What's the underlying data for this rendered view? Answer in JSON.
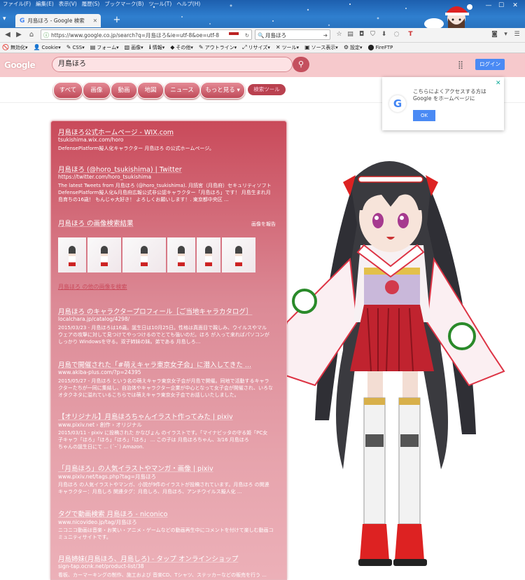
{
  "browser": {
    "menu": [
      "ファイル(F)",
      "編集(E)",
      "表示(V)",
      "履歴(S)",
      "ブックマーク(B)",
      "ツール(T)",
      "ヘルプ(H)"
    ],
    "tab_title": "月島ほろ - Google 検索",
    "url": "https://www.google.co.jp/search?q=月島ほろ&ie=utf-8&oe=utf-8",
    "search_value": "月島ほろ",
    "bookmarks": [
      {
        "icon": "🚫",
        "label": "無効化▾"
      },
      {
        "icon": "👤",
        "label": "Cookie▾"
      },
      {
        "icon": "✎",
        "label": "CSS▾"
      },
      {
        "icon": "▤",
        "label": "フォーム▾"
      },
      {
        "icon": "▧",
        "label": "画像▾"
      },
      {
        "icon": "ℹ",
        "label": "情報▾"
      },
      {
        "icon": "◆",
        "label": "その他▾"
      },
      {
        "icon": "✎",
        "label": "アウトライン▾"
      },
      {
        "icon": "⤢",
        "label": "リサイズ▾"
      },
      {
        "icon": "✕",
        "label": "ツール▾"
      },
      {
        "icon": "▣",
        "label": "ソース表示▾"
      },
      {
        "icon": "⚙",
        "label": "設定▾"
      },
      {
        "icon": "⬤",
        "label": "FireFTP"
      }
    ]
  },
  "google": {
    "logo": "Google",
    "query": "月島ほろ",
    "login": "ログイン",
    "tabs": [
      "すべて",
      "画像",
      "動画",
      "地図",
      "ニュース",
      "もっと見る ▾"
    ],
    "tools": "検索ツール",
    "popup": {
      "text": "こちらによくアクセスする方は Google をホームページに",
      "ok": "OK"
    }
  },
  "results": [
    {
      "title": "月島ほろ公式ホームページ - WIX.com",
      "url": "tsukishima.wix.com/horo",
      "snippet": [
        "DefensePlatform擬人化キャラクター 月島ほろ の公式ホームページ。"
      ]
    },
    {
      "title": "月島ほろ (@horo_tsukishima) | Twitter",
      "url": "https://twitter.com/horo_tsukishima",
      "snippet": [
        "The latest Tweets from 月島ほろ (@horo_tsukishima). 月読宮（月島府）セキュリティソフト",
        "DefensePlatform擬人化&月島府広報公式非公認キャラクター「月島ほろ」です！ 月島生まれ月",
        "島育ちの16歳！ もんじゃ大好き！ よろしくお願いします！. 東京都中央区 ..."
      ]
    },
    {
      "title": "月島ほろ のキャラクタープロフィール［ご当地キャラカタログ］",
      "url": "localchara.jp/catalog/4298/",
      "snippet": [
        "2015/03/23 - 月島ほろは16歳。誕生日は10月25日。性格は真面目で親しみ、ウイルスやマル",
        "ウェアの攻撃に対して見つけてやっつけるのでとても強いのだ。ほろ が入って来ればパソコンが",
        "しっかり Windowsを守る。双子姉妹の妹。弟である 月島しろ..."
      ]
    },
    {
      "title": "月島で開催された「#萌えキャラ東京女子会」に潜入してきた ...",
      "url": "www.akiba-plus.com/?p=24395",
      "snippet": [
        "2015/05/27 - 月島ほろ という名の萌えキャラ東京女子会が月島で開催。同地で活動するキャラ",
        "クターたちが一同に集結し、自治体やキャラクター企業が中心となって女子会が開催され、いろな",
        "オタクネタに溢れているこちらでは萌えキャラ東京女子会でお話しいたしました。"
      ]
    },
    {
      "title": "【オリジナル】月島ほろちゃんイラスト作ってみた | pixiv",
      "url": "www.pixiv.net › 創作 › オリジナル",
      "snippet": [
        "2015/03/11 - pixiv に投稿された かなぴょん のイラストです。「マイナビッタの守る姫「PC女",
        "子キャラ「ほろ」「ほろ」「ほろ」「ほろ」 ... この子は 月島ほろちゃん、3/16 月島ほろ",
        "ちゃんの誕生日にて ... (´ｰ`) Amazon."
      ]
    },
    {
      "title": "「月島ほろ」の人気イラストやマンガ・画像 | pixiv",
      "url": "www.pixiv.net/tags.php?tag=月島ほろ",
      "snippet": [
        "月島ほろ の人気イラストやマンガ、小説が9件のイラストが投稿されています。月島ほろ の関連",
        "キャラクター：月島しろ 関連タグ：月島しろ、月島ほろ、アンチウイルス擬人化 ..."
      ]
    },
    {
      "title": "タグで動画検索 月島ほろ - niconico",
      "url": "www.nicovideo.jp/tag/月島ほろ",
      "snippet": [
        "ニコニコ動画は音楽・お笑い・アニメ・ゲームなどの動画再生中にコメントを付けて楽しむ動画コ",
        "ミュニティサイトです。"
      ]
    },
    {
      "title": "月島姉妹(月島ほろ、月島しろ) - タップ オンラインショップ",
      "url": "sign-tap.ocnk.net/product-list/38",
      "snippet": [
        "看板、カーマーキングの制作、施工および 音楽CD、Tシャツ、ステッカーなどの販売を行う ..."
      ]
    }
  ],
  "image_section": {
    "title": "月島ほろ の画像検索結果",
    "more": "画像を報告",
    "link": "月島ほろ の他の画像を検索"
  }
}
